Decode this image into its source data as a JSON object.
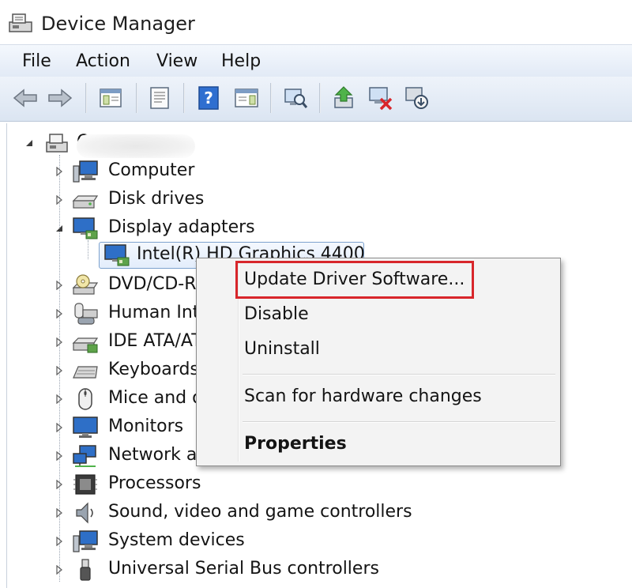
{
  "window": {
    "title": "Device Manager"
  },
  "menu": [
    "File",
    "Action",
    "View",
    "Help"
  ],
  "toolbar": {
    "buttons": [
      "back-icon",
      "forward-icon",
      "show-hide-console-tree-icon",
      "properties-icon",
      "help-icon",
      "action-pane-icon",
      "scan-hardware-icon",
      "update-driver-icon",
      "uninstall-device-icon",
      "disable-device-icon"
    ]
  },
  "tree": {
    "root": {
      "name": "C",
      "blurred": true
    },
    "categories": [
      {
        "label": "Computer",
        "icon": "computer-icon",
        "expanded": false
      },
      {
        "label": "Disk drives",
        "icon": "disk-drive-icon",
        "expanded": false
      },
      {
        "label": "Display adapters",
        "icon": "display-adapter-icon",
        "expanded": true
      },
      {
        "label": "Intel(R) HD Graphics 4400",
        "icon": "display-adapter-icon",
        "child": true,
        "selected": true
      },
      {
        "label": "DVD/CD-ROM drives",
        "icon": "dvd-drive-icon",
        "expanded": false
      },
      {
        "label": "Human Interface Devices",
        "icon": "hid-icon",
        "expanded": false
      },
      {
        "label": "IDE ATA/ATAPI controllers",
        "icon": "ide-controller-icon",
        "expanded": false
      },
      {
        "label": "Keyboards",
        "icon": "keyboard-icon",
        "expanded": false
      },
      {
        "label": "Mice and other pointing devices",
        "icon": "mouse-icon",
        "expanded": false
      },
      {
        "label": "Monitors",
        "icon": "monitor-icon",
        "expanded": false
      },
      {
        "label": "Network adapters",
        "icon": "network-adapter-icon",
        "expanded": false
      },
      {
        "label": "Processors",
        "icon": "processor-icon",
        "expanded": false
      },
      {
        "label": "Sound, video and game controllers",
        "icon": "speaker-icon",
        "expanded": false
      },
      {
        "label": "System devices",
        "icon": "system-devices-icon",
        "expanded": false
      },
      {
        "label": "Universal Serial Bus controllers",
        "icon": "usb-icon",
        "expanded": false
      }
    ]
  },
  "context_menu": {
    "items": [
      {
        "label": "Update Driver Software...",
        "highlighted": true
      },
      {
        "label": "Disable"
      },
      {
        "label": "Uninstall"
      },
      {
        "label": "Scan for hardware changes"
      },
      {
        "label": "Properties",
        "bold": true
      }
    ]
  },
  "colors": {
    "highlight_border": "#d8262b",
    "menubar": "#e2eaf6",
    "selection": "#7da2ce"
  }
}
